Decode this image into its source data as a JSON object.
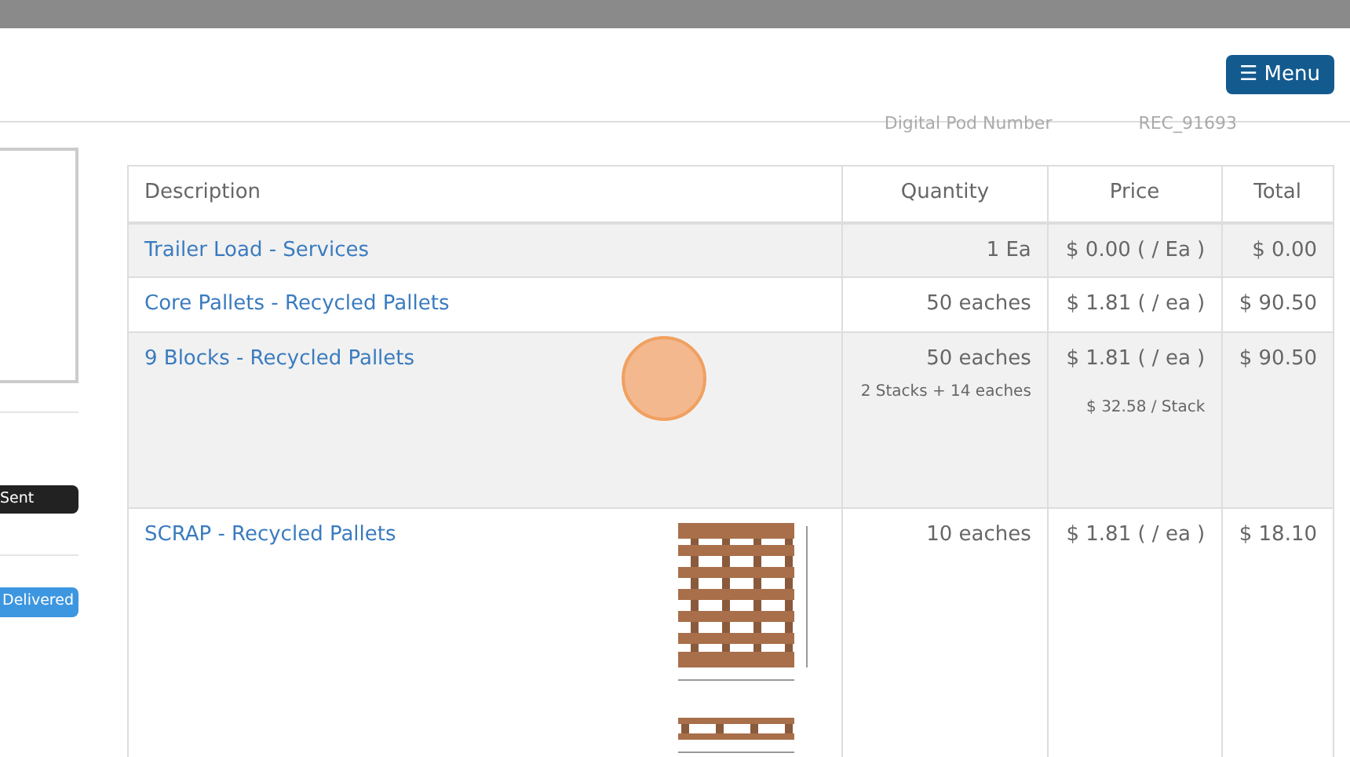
{
  "header": {
    "menu_button": {
      "icon": "☰",
      "label": "Menu"
    }
  },
  "pod": {
    "label": "Digital Pod Number",
    "value": "REC_91693"
  },
  "status_badges": [
    {
      "label": "Sent",
      "kind": "sent"
    },
    {
      "label": "Delivered",
      "kind": "delivered"
    }
  ],
  "table": {
    "columns": [
      "Description",
      "Quantity",
      "Price",
      "Total"
    ],
    "rows": [
      {
        "description": "Trailer Load - Services",
        "quantity": "1 Ea",
        "price": "$ 0.00 ( / Ea )",
        "total": "$ 0.00"
      },
      {
        "description": "Core Pallets - Recycled Pallets",
        "quantity": "50 eaches",
        "price": "$ 1.81 ( / ea )",
        "total": "$ 90.50"
      },
      {
        "description": "9 Blocks - Recycled Pallets",
        "quantity": "50 eaches",
        "quantity_note": "2 Stacks + 14 eaches",
        "price": "$ 1.81 ( / ea )",
        "price_note": "$ 32.58 / Stack",
        "total": "$ 90.50"
      },
      {
        "description": "SCRAP - Recycled Pallets",
        "quantity": "10 eaches",
        "price": "$ 1.81 ( / ea )",
        "total": "$ 18.10",
        "diagram": true
      }
    ]
  }
}
